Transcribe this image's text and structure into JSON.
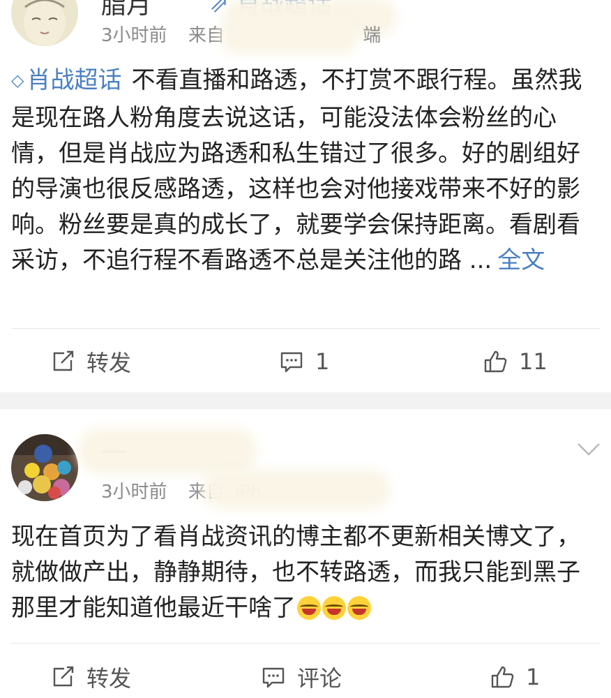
{
  "posts": [
    {
      "author_visible": "脂月",
      "topic_link": "肖战超话",
      "time": "3小时前",
      "source_prefix": "来自",
      "source_tail": "端",
      "supertopic": "肖战超话",
      "text": "不看直播和路透，不打赏不跟行程。虽然我是现在路人粉角度去说这话，可能没法体会粉丝的心情，但是肖战应为路透和私生错过了很多。好的剧组好的导演也很反感路透，这样也会对他接戏带来不好的影响。粉丝要是真的成长了，就要学会保持距离。看剧看采访，不追行程不看路透不总是关注他的路 ...",
      "full_text_link": "全文",
      "repost_label": "转发",
      "comment_label": "1",
      "like_label": "11"
    },
    {
      "author_visible": "一",
      "time": "3小时前",
      "source_prefix": "来自",
      "source_tail": "iPh",
      "text": "现在首页为了看肖战资讯的博主都不更新相关博文了，就做做产出，静静期待，也不转路透，而我只能到黑子那里才能知道他最近干啥了",
      "emoji_count": 3,
      "repost_label": "转发",
      "comment_label": "评论",
      "like_label": "1"
    }
  ],
  "icons": {
    "repost": "repost-icon",
    "comment": "comment-icon",
    "like": "thumbs-up-icon",
    "expand": "chevron-down-icon",
    "supertopic": "diamond-icon",
    "emoji": "laugh-cry-emoji"
  },
  "colors": {
    "link": "#4a7fc1",
    "meta": "#8a8a8a",
    "text": "#222222",
    "separator": "#f2f2f2"
  }
}
